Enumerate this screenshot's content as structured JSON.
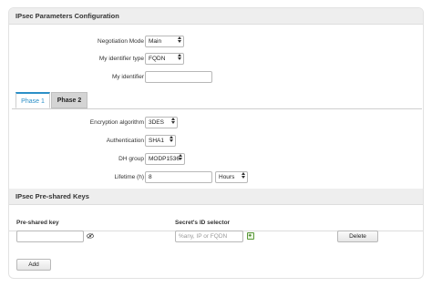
{
  "sections": {
    "ipsec_params_title": "IPsec Parameters Configuration",
    "psk_title": "IPsec Pre-shared Keys"
  },
  "fields": {
    "negotiation_mode": {
      "label": "Negotiation Mode",
      "value": "Main"
    },
    "my_identifier_type": {
      "label": "My identifier type",
      "value": "FQDN"
    },
    "my_identifier": {
      "label": "My identifier",
      "value": ""
    }
  },
  "tabs": [
    {
      "label": "Phase 1",
      "active": true
    },
    {
      "label": "Phase 2",
      "active": false
    }
  ],
  "phase1": {
    "encryption": {
      "label": "Encryption algorithm",
      "value": "3DES"
    },
    "authentication": {
      "label": "Authentication",
      "value": "SHA1"
    },
    "dh_group": {
      "label": "DH group",
      "value": "MODP1536"
    },
    "lifetime": {
      "label": "Lifetime (h)",
      "value": "8",
      "unit": "Hours"
    }
  },
  "psk_table": {
    "columns": [
      "Pre-shared key",
      "Secret's ID selector"
    ],
    "row": {
      "key_value": "",
      "selector_placeholder": "%any, IP or FQDN",
      "delete_label": "Delete"
    }
  },
  "add_label": "Add",
  "icons": [
    "show-password-icon",
    "add-selector-icon",
    "dropdown-arrow-icon"
  ],
  "colors": {
    "accent": "#2b8fc7",
    "header_bg": "#eeeeee"
  }
}
